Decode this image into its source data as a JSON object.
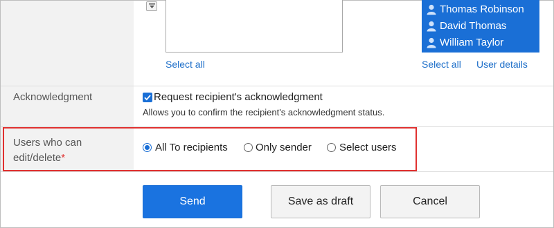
{
  "recipients": {
    "selected_users": [
      {
        "name": "Thomas Robinson"
      },
      {
        "name": "David Thomas"
      },
      {
        "name": "William Taylor"
      }
    ],
    "left_select_all": "Select all",
    "right_select_all": "Select all",
    "user_details": "User details"
  },
  "acknowledgment": {
    "label": "Acknowledgment",
    "checkbox_label": "Request recipient's acknowledgment",
    "checked": true,
    "description": "Allows you to confirm the recipient's acknowledgment status."
  },
  "edit_permission": {
    "label_line1": "Users who can",
    "label_line2": "edit/delete",
    "required_mark": "*",
    "options": [
      {
        "label": "All To recipients",
        "selected": true
      },
      {
        "label": "Only sender",
        "selected": false
      },
      {
        "label": "Select users",
        "selected": false
      }
    ]
  },
  "buttons": {
    "send": "Send",
    "save_draft": "Save as draft",
    "cancel": "Cancel"
  },
  "colors": {
    "accent": "#1a73e0",
    "highlight": "#e0302f",
    "link": "#1e6fc9"
  }
}
